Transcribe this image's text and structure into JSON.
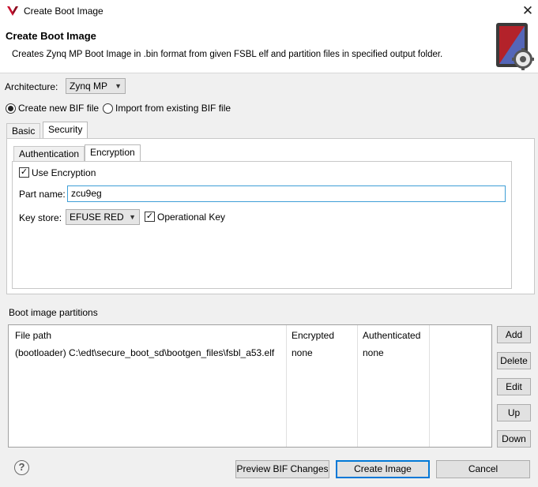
{
  "window": {
    "title": "Create Boot Image"
  },
  "header": {
    "title": "Create Boot Image",
    "description": "Creates Zynq MP Boot Image in .bin format from given FSBL elf and partition files in specified output folder."
  },
  "architecture": {
    "label": "Architecture:",
    "value": "Zynq MP"
  },
  "bif_options": {
    "create_new": "Create new BIF file",
    "import_existing": "Import from existing BIF file",
    "selected": "create_new"
  },
  "outer_tabs": [
    "Basic",
    "Security"
  ],
  "inner_tabs": [
    "Authentication",
    "Encryption"
  ],
  "encryption": {
    "use_encryption_label": "Use Encryption",
    "use_encryption_checked": true,
    "part_name_label": "Part name:",
    "part_name_value": "zcu9eg",
    "key_store_label": "Key store:",
    "key_store_value": "EFUSE RED",
    "operational_key_label": "Operational Key",
    "operational_key_checked": true
  },
  "partitions": {
    "label": "Boot image partitions",
    "columns": [
      "File path",
      "Encrypted",
      "Authenticated"
    ],
    "rows": [
      {
        "file": "(bootloader) C:\\edt\\secure_boot_sd\\bootgen_files\\fsbl_a53.elf",
        "encrypted": "none",
        "authenticated": "none"
      }
    ],
    "buttons": {
      "add": "Add",
      "delete": "Delete",
      "edit": "Edit",
      "up": "Up",
      "down": "Down"
    }
  },
  "footer": {
    "help": "?",
    "preview": "Preview BIF Changes",
    "create": "Create Image",
    "cancel": "Cancel"
  },
  "icons": {
    "app": "vivado-logo-icon",
    "header": "boot-image-gear-icon",
    "close": "close-icon"
  },
  "colors": {
    "accent": "#0078d7",
    "logo_red": "#c8102e"
  }
}
